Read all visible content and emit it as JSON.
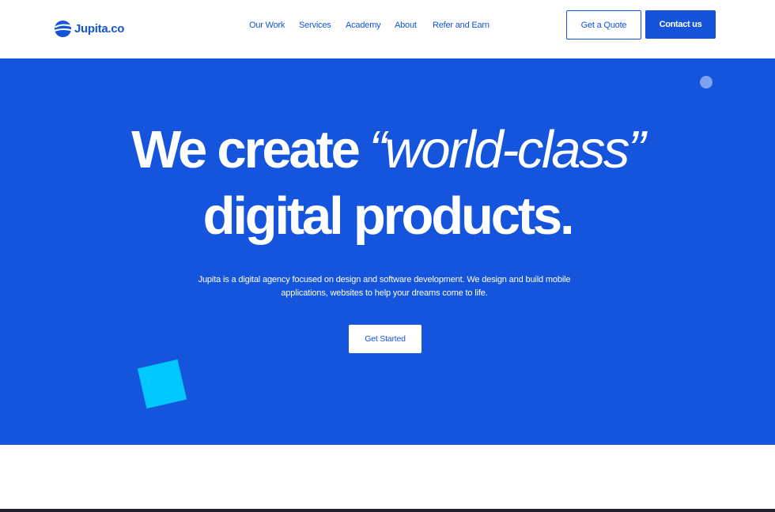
{
  "brand": {
    "name": "Jupita.co",
    "icon": "jupita-planet-logo-icon",
    "color": "#1554d8"
  },
  "nav": {
    "items": [
      {
        "label": "Our Work"
      },
      {
        "label": "Services"
      },
      {
        "label": "Academy"
      },
      {
        "label": "About"
      },
      {
        "label": "Refer and Earn"
      }
    ]
  },
  "header_buttons": {
    "quote_label": "Get a Quote",
    "contact_label": "Contact us"
  },
  "hero": {
    "title_part1": "We create",
    "title_italic": "“world-class”",
    "title_line2": "digital products.",
    "description": "Jupita is a digital agency focused on design and software development. We design and build mobile applications, websites to help your dreams come to life.",
    "cta_label": "Get Started",
    "background_color": "#1554dc",
    "accent_square_color": "#00c8ff",
    "accent_dot_color": "#7ea3f2"
  }
}
